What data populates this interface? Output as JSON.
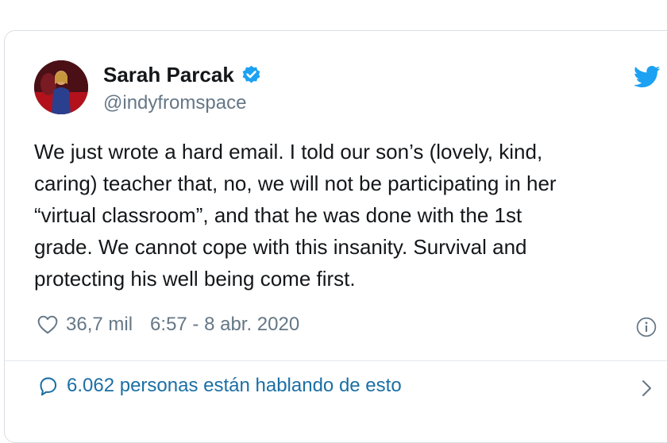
{
  "tweet": {
    "display_name": "Sarah Parcak",
    "handle": "@indyfromspace",
    "verified": true,
    "text": "We just wrote a hard email. I told our son’s (lovely, kind,\ncaring) teacher that, no, we will not be participating in her\n“virtual classroom”, and that he was done with the 1st\ngrade. We cannot cope with this insanity. Survival and\nprotecting his well being come first.",
    "likes": "36,7 mil",
    "timestamp": "6:57 - 8 abr. 2020",
    "conversation": "6.062 personas están hablando de esto"
  },
  "colors": {
    "brand_blue": "#1da1f2",
    "link_blue": "#1b6fa5",
    "text": "#14171a",
    "secondary": "#657786",
    "border": "#d9dfe4"
  },
  "icons": {
    "verified": "verified-badge-icon",
    "logo": "twitter-bird-icon",
    "like": "heart-icon",
    "info": "info-icon",
    "reply": "speech-bubble-icon",
    "chevron": "chevron-right-icon"
  }
}
